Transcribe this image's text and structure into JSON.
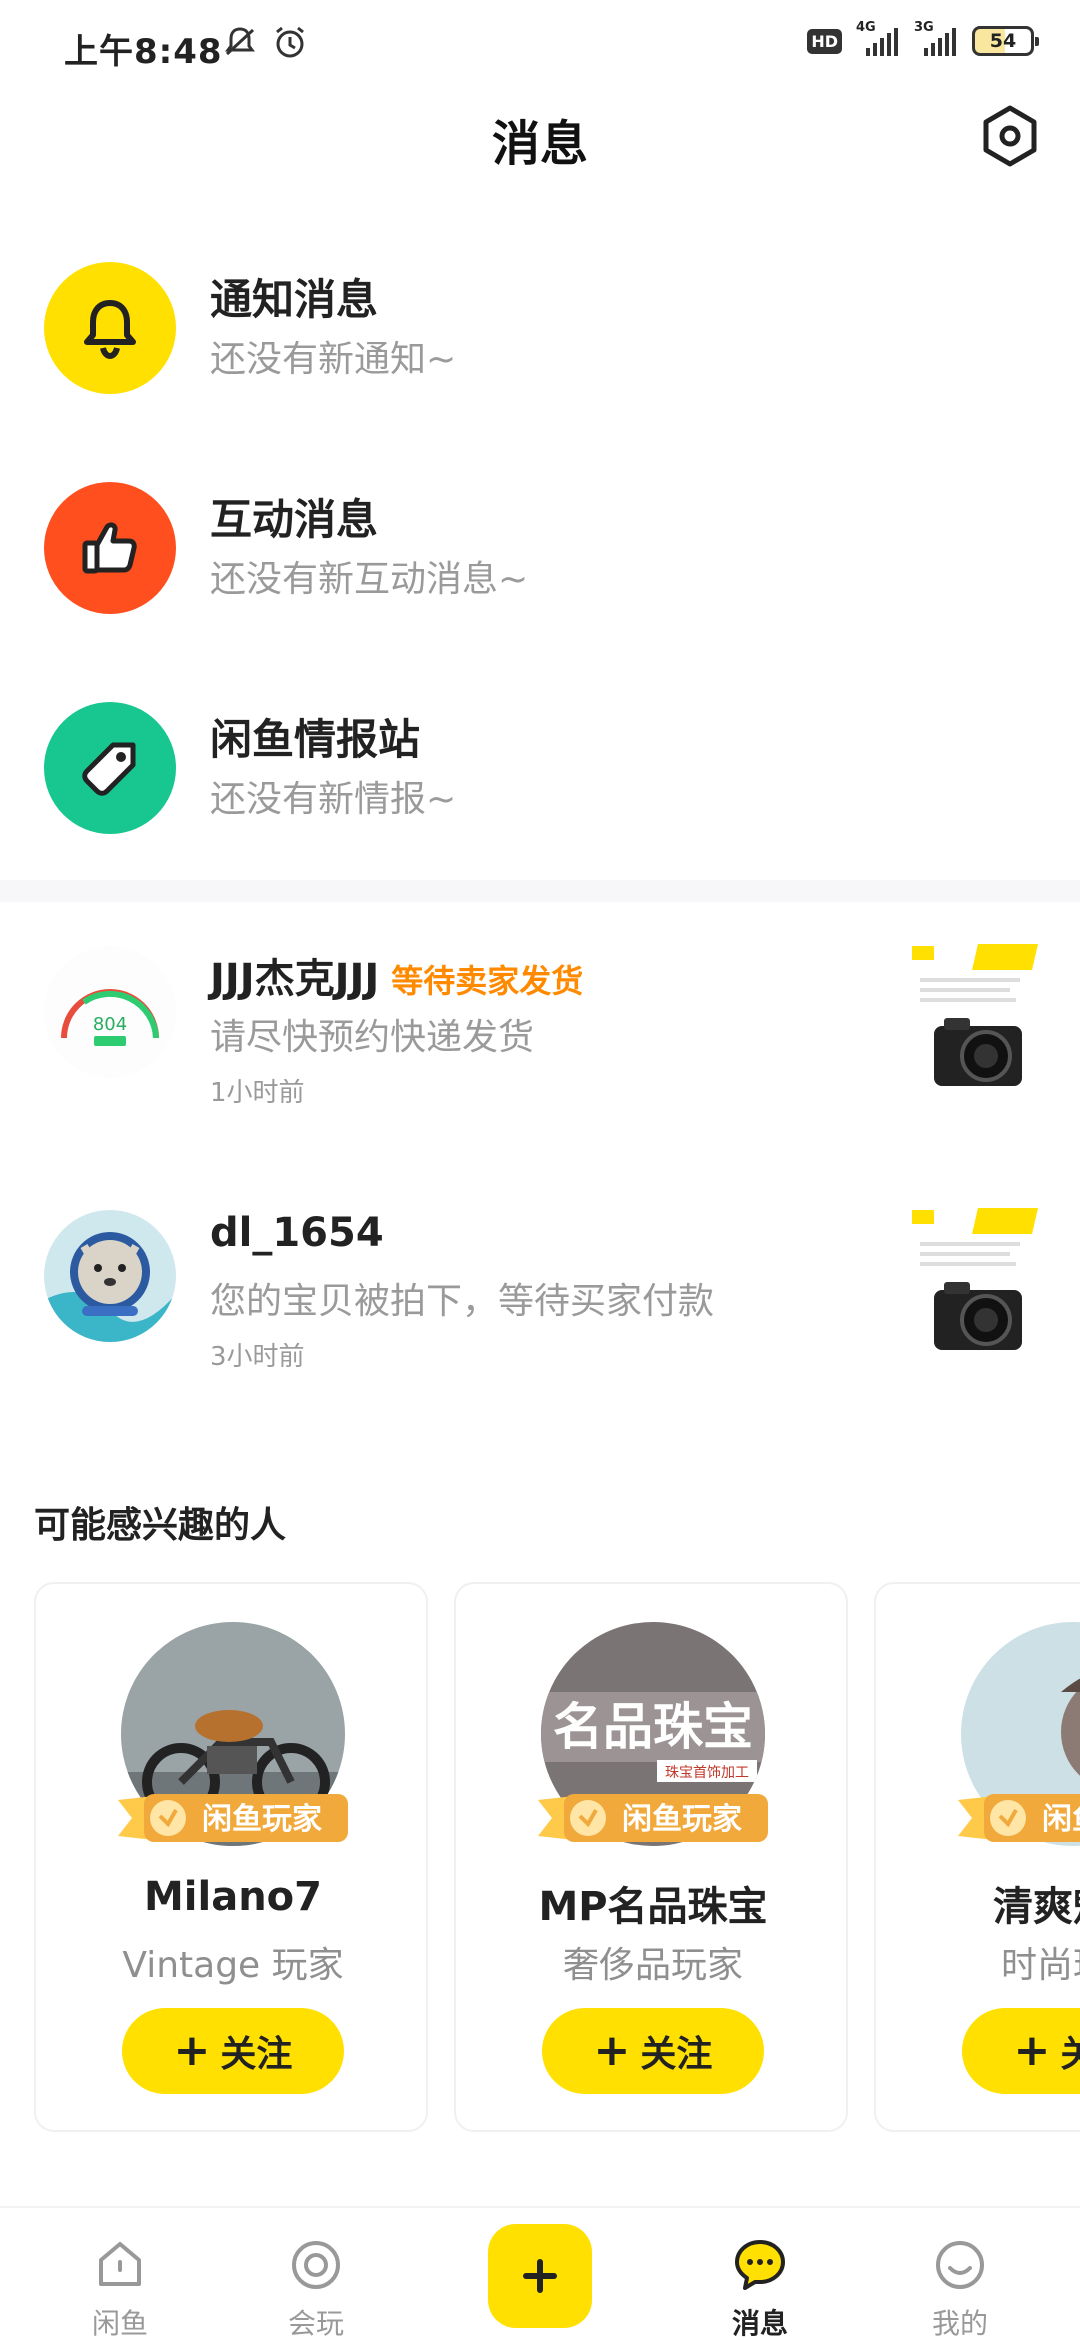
{
  "status_bar": {
    "time": "上午8:48",
    "hd": "HD",
    "network_1": "4G",
    "network_2": "3G",
    "battery": "54"
  },
  "header": {
    "title": "消息"
  },
  "system_messages": [
    {
      "title": "通知消息",
      "subtitle": "还没有新通知~",
      "icon": "bell-icon",
      "color": "#ffe000"
    },
    {
      "title": "互动消息",
      "subtitle": "还没有新互动消息~",
      "icon": "thumbs-up-icon",
      "color": "#ff4f1f"
    },
    {
      "title": "闲鱼情报站",
      "subtitle": "还没有新情报~",
      "icon": "tag-icon",
      "color": "#17c78f"
    }
  ],
  "chats": [
    {
      "name": "JJJ杰克JJJ",
      "tag": "等待卖家发货",
      "message": "请尽快预约快递发货",
      "time": "1小时前",
      "gauge_value": "804"
    },
    {
      "name": "dl_1654",
      "tag": "",
      "message": "您的宝贝被拍下，等待买家付款",
      "time": "3小时前"
    }
  ],
  "suggestions": {
    "title": "可能感兴趣的人",
    "badge_label": "闲鱼玩家",
    "follow_label": "关注",
    "people": [
      {
        "name": "Milano7",
        "subtitle": "Vintage 玩家"
      },
      {
        "name": "MP名品珠宝",
        "subtitle": "奢侈品玩家",
        "avatar_text": "名品珠宝",
        "avatar_subtext": "珠宝首饰加工"
      },
      {
        "name": "清爽魅力",
        "subtitle": "时尚玩家"
      }
    ]
  },
  "bottom_nav": [
    {
      "label": "闲鱼",
      "icon": "home-icon",
      "active": false
    },
    {
      "label": "会玩",
      "icon": "circle-icon",
      "active": false
    },
    {
      "label": "",
      "icon": "plus-icon",
      "active": false
    },
    {
      "label": "消息",
      "icon": "message-icon",
      "active": true
    },
    {
      "label": "我的",
      "icon": "smile-icon",
      "active": false
    }
  ],
  "colors": {
    "accent": "#ffe000",
    "tag_orange": "#ff8a00",
    "muted_text": "#9a9a9a"
  }
}
